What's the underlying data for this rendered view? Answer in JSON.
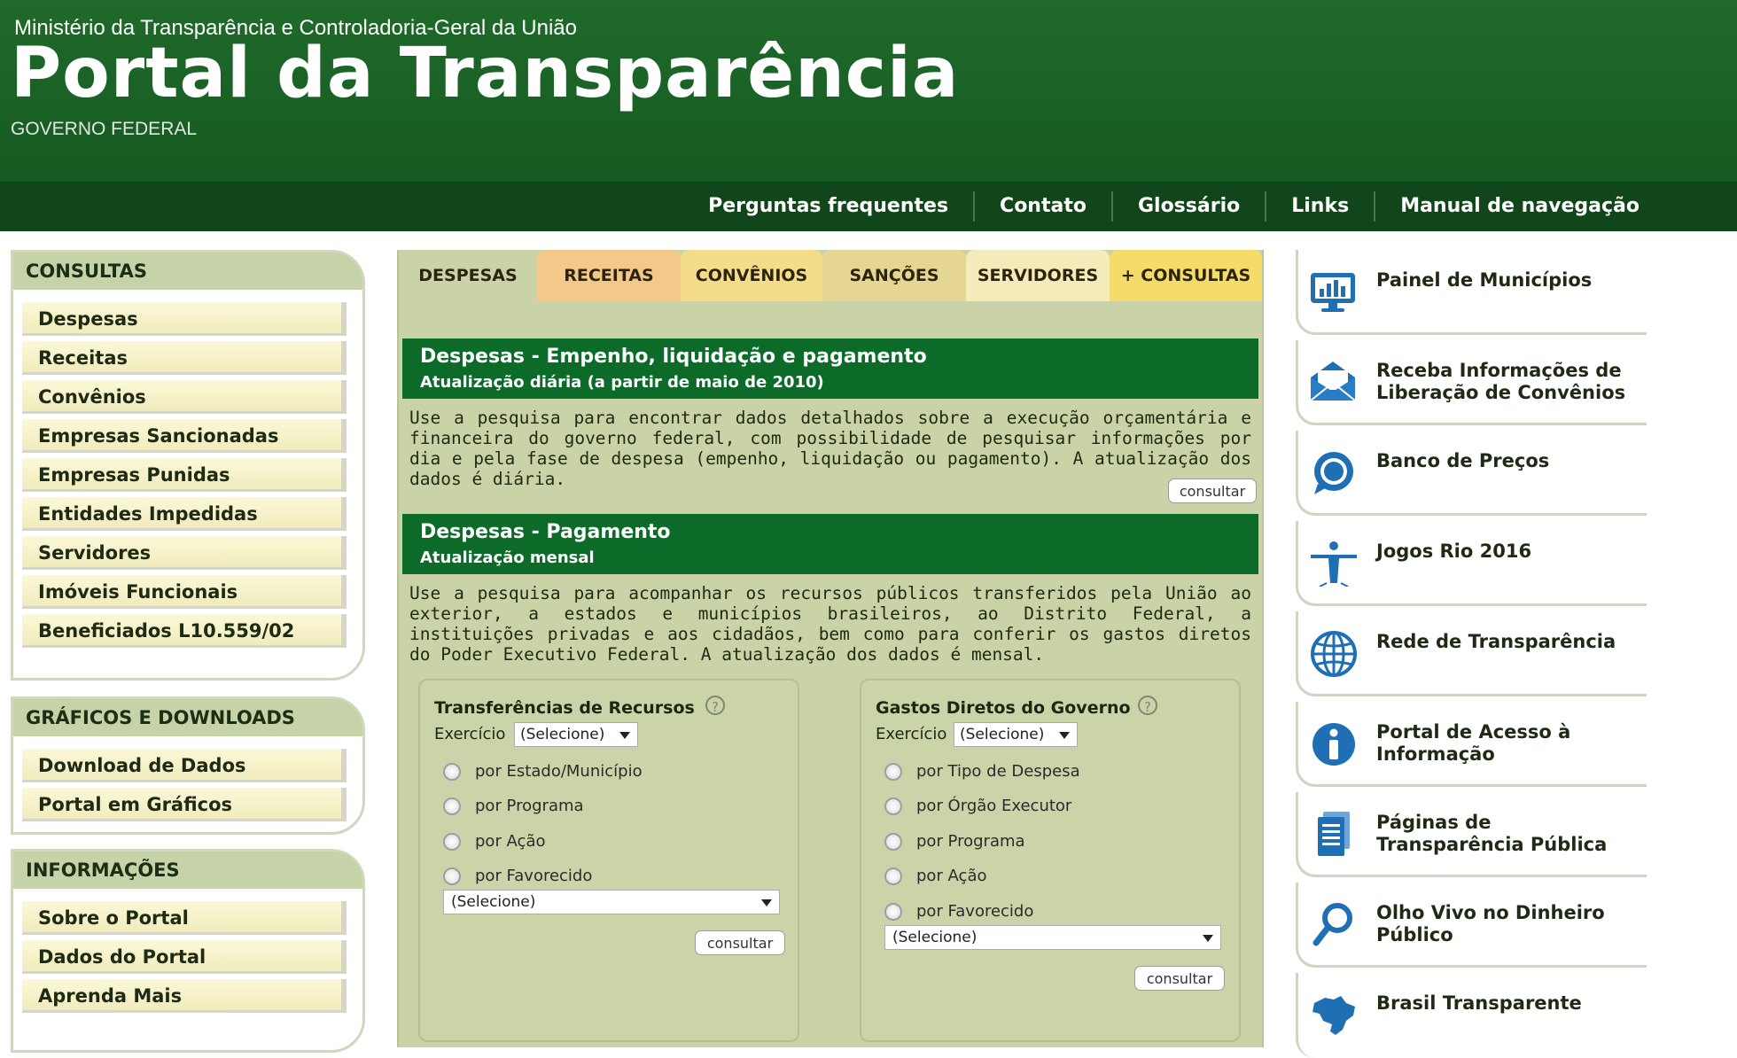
{
  "header": {
    "ministry": "Ministério da Transparência e Controladoria-Geral da União",
    "title": "Portal da Transparência",
    "subtitle": "GOVERNO FEDERAL",
    "nav": [
      "Perguntas frequentes",
      "Contato",
      "Glossário",
      "Links",
      "Manual de navegação"
    ]
  },
  "sidebar": {
    "consultas": {
      "heading": "CONSULTAS",
      "items": [
        "Despesas",
        "Receitas",
        "Convênios",
        "Empresas Sancionadas",
        "Empresas Punidas",
        "Entidades Impedidas",
        "Servidores",
        "Imóveis Funcionais",
        "Beneficiados L10.559/02"
      ]
    },
    "graficos": {
      "heading": "GRÁFICOS E DOWNLOADS",
      "items": [
        "Download de Dados",
        "Portal em Gráficos"
      ]
    },
    "informacoes": {
      "heading": "INFORMAÇÕES",
      "items": [
        "Sobre o Portal",
        "Dados do Portal",
        "Aprenda Mais"
      ]
    }
  },
  "tabs": [
    "DESPESAS",
    "RECEITAS",
    "CONVÊNIOS",
    "SANÇÕES",
    "SERVIDORES",
    "+ CONSULTAS"
  ],
  "panel1": {
    "title": "Despesas - Empenho, liquidação e pagamento",
    "subtitle": "Atualização diária (a partir de maio de 2010)",
    "text": "Use a pesquisa para encontrar dados detalhados sobre a execução orçamentária e financeira do governo federal, com possibilidade de pesquisar informações por dia e pela fase de despesa (empenho, liquidação ou pagamento). A atualização dos dados é diária.",
    "button": "consultar"
  },
  "panel2": {
    "title": "Despesas - Pagamento",
    "subtitle": "Atualização mensal",
    "text": "Use a pesquisa para acompanhar os recursos públicos transferidos pela União ao exterior, a estados e municípios brasileiros, ao Distrito Federal, a instituições privadas e aos cidadãos, bem como para conferir os gastos diretos do Poder Executivo Federal. A atualização dos dados é mensal."
  },
  "transferencias": {
    "title": "Transferências de Recursos",
    "help": "?",
    "exercicio_label": "Exercício",
    "exercicio_value": "(Selecione)",
    "options": [
      "por Estado/Município",
      "por Programa",
      "por Ação",
      "por Favorecido"
    ],
    "select_value": "(Selecione)",
    "button": "consultar"
  },
  "gastos": {
    "title": "Gastos Diretos do Governo",
    "help": "?",
    "exercicio_label": "Exercício",
    "exercicio_value": "(Selecione)",
    "options": [
      "por Tipo de Despesa",
      "por Órgão Executor",
      "por Programa",
      "por Ação",
      "por Favorecido"
    ],
    "select_value": "(Selecione)",
    "button": "consultar"
  },
  "right": [
    {
      "label": "Painel de Municípios",
      "icon": "monitor-chart-icon"
    },
    {
      "label": "Receba Informações de Liberação de Convênios",
      "icon": "envelope-icon"
    },
    {
      "label": "Banco de Preços",
      "icon": "speech-bubble-icon"
    },
    {
      "label": "Jogos Rio 2016",
      "icon": "christ-statue-icon"
    },
    {
      "label": "Rede de Transparência",
      "icon": "globe-icon"
    },
    {
      "label": "Portal de Acesso à Informação",
      "icon": "info-icon"
    },
    {
      "label": "Páginas de Transparência Pública",
      "icon": "document-icon"
    },
    {
      "label": "Olho Vivo no Dinheiro Público",
      "icon": "magnifier-icon"
    },
    {
      "label": "Brasil Transparente",
      "icon": "brazil-map-icon"
    }
  ],
  "colors": {
    "header_green": "#1f6a2a",
    "nav_green": "#11461b",
    "panel_green": "#0d6b2a",
    "content_bg": "#c9d3a7",
    "icon_blue": "#1f6fb5"
  }
}
